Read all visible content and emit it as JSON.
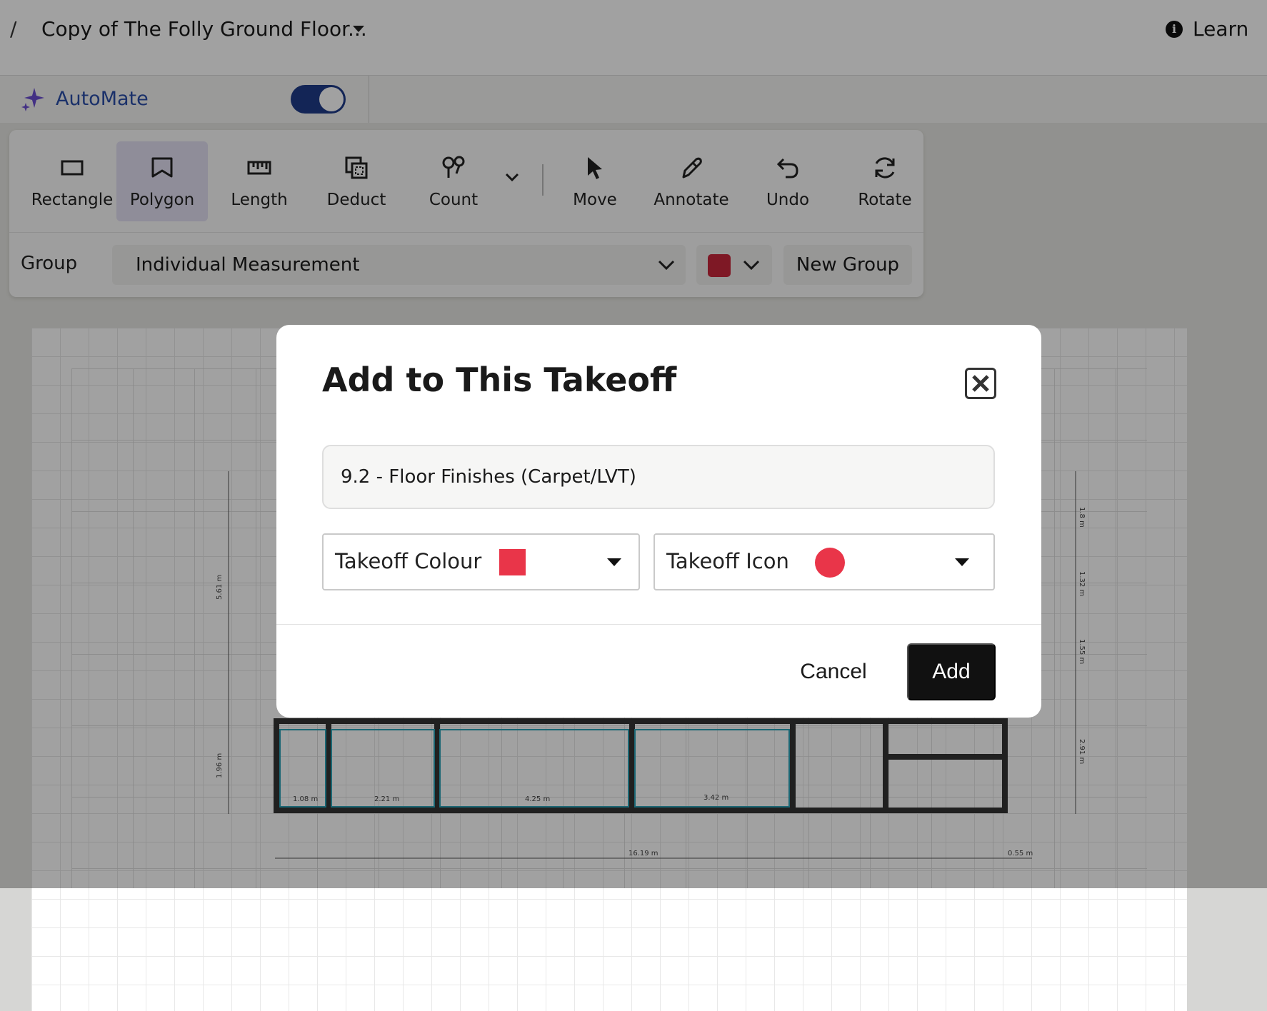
{
  "header": {
    "slash": "/",
    "title": "Copy of The Folly Ground Floor...",
    "learn_label": "Learn"
  },
  "automate": {
    "label": "AutoMate",
    "enabled": true
  },
  "toolbar": {
    "tools": [
      {
        "label": "Rectangle",
        "icon": "rectangle-icon"
      },
      {
        "label": "Polygon",
        "icon": "polygon-icon",
        "active": true
      },
      {
        "label": "Length",
        "icon": "ruler-icon"
      },
      {
        "label": "Deduct",
        "icon": "deduct-icon"
      },
      {
        "label": "Count",
        "icon": "count-icon"
      },
      {
        "label": "Move",
        "icon": "cursor-icon"
      },
      {
        "label": "Annotate",
        "icon": "pen-icon"
      },
      {
        "label": "Undo",
        "icon": "undo-icon"
      },
      {
        "label": "Rotate",
        "icon": "rotate-icon"
      }
    ],
    "group_label": "Group",
    "group_value": "Individual Measurement",
    "group_colour": "#c8263b",
    "new_group_label": "New Group"
  },
  "modal": {
    "title": "Add to This Takeoff",
    "name_value": "9.2 - Floor Finishes (Carpet/LVT)",
    "colour_label": "Takeoff Colour",
    "colour_value": "#e93549",
    "icon_label": "Takeoff Icon",
    "icon_value": "circle",
    "cancel_label": "Cancel",
    "add_label": "Add"
  },
  "drawing_labels": [
    "5.61 m",
    "1.96 m",
    "16.19 m",
    "0.55 m",
    "1.8 m",
    "1.32 m",
    "1.55 m",
    "2.91 m",
    "1.08 m",
    "2.21 m",
    "4.25 m",
    "3.42 m"
  ]
}
